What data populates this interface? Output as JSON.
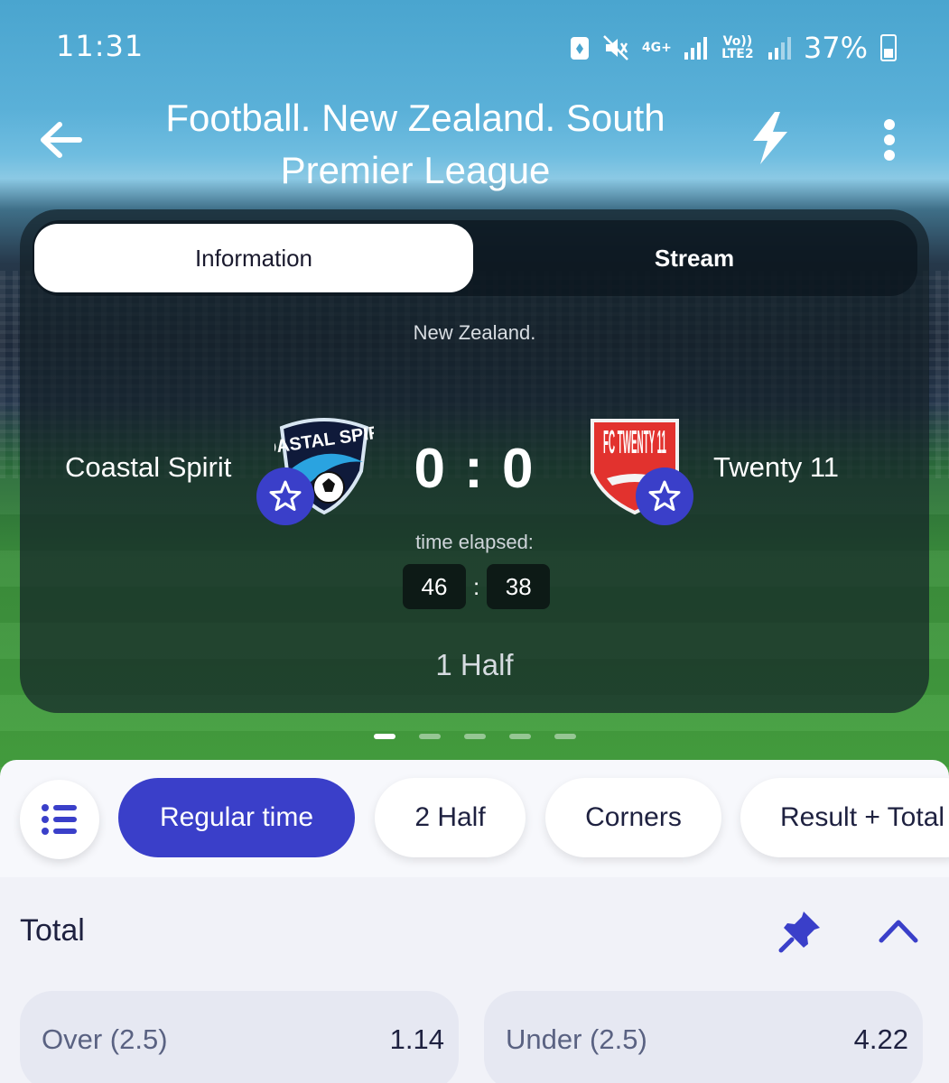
{
  "status_bar": {
    "time": "11:31",
    "network_4g": "4G+",
    "volte": "Vo)) LTE2",
    "battery_percent": "37%"
  },
  "header": {
    "title": "Football. New Zealand. South Premier League",
    "icons": [
      "back-arrow-icon",
      "lightning-icon",
      "more-vert-icon"
    ]
  },
  "tabs": [
    {
      "label": "Information",
      "active": true
    },
    {
      "label": "Stream",
      "active": false
    }
  ],
  "match": {
    "country": "New Zealand.",
    "home_team": "Coastal Spirit",
    "away_team": "Twenty 11",
    "home_logo_text": "COASTAL SPIRIT",
    "away_logo_text": "FC TWENTY 11",
    "score": "0 : 0",
    "elapsed_label": "time elapsed:",
    "elapsed_minutes": "46",
    "elapsed_seconds": "38",
    "period": "1 Half"
  },
  "carousel": {
    "pages": 5,
    "active_index": 0
  },
  "filters": [
    {
      "label": "Regular time",
      "active": true
    },
    {
      "label": "2 Half",
      "active": false
    },
    {
      "label": "Corners",
      "active": false
    },
    {
      "label": "Result + Total",
      "active": false
    }
  ],
  "market": {
    "title": "Total",
    "outcomes": [
      {
        "label": "Over (2.5)",
        "odds": "1.14"
      },
      {
        "label": "Under (2.5)",
        "odds": "4.22"
      }
    ]
  },
  "colors": {
    "accent": "#3a3fc9",
    "sky": "#4aa5cf",
    "pitch": "#46a23f",
    "text_dark": "#1e2140"
  }
}
